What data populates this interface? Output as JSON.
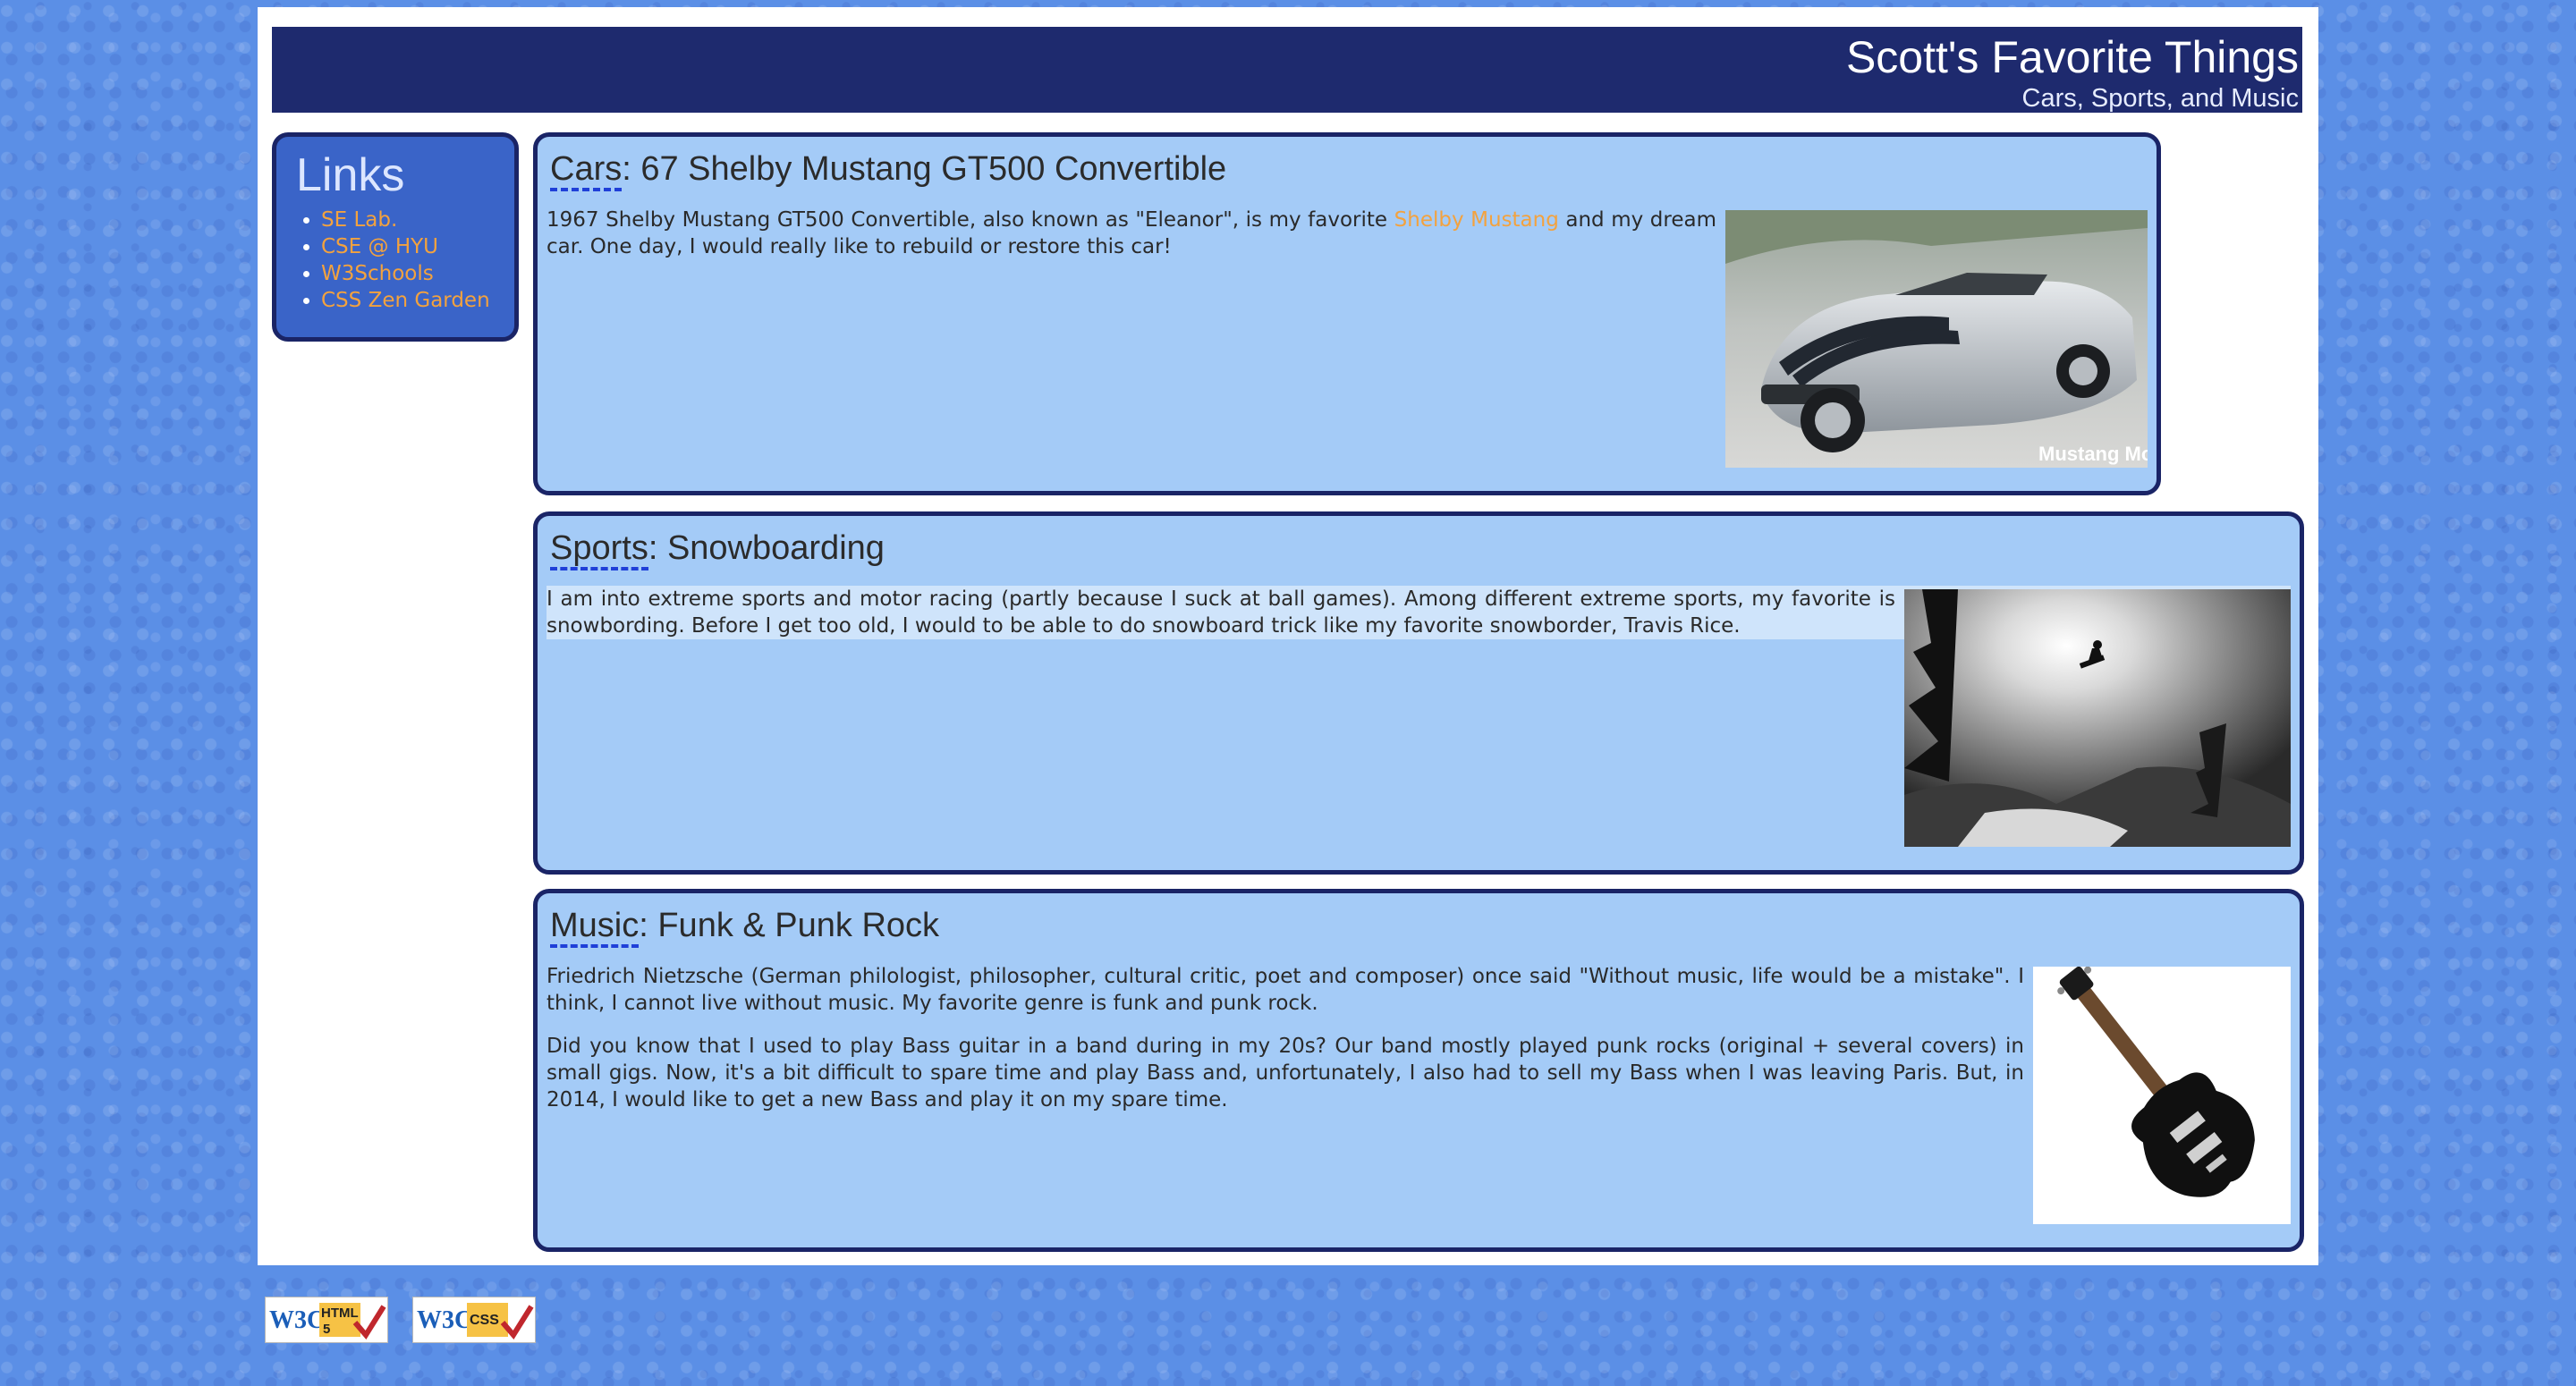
{
  "header": {
    "title": "Scott's Favorite Things",
    "subtitle": "Cars, Sports, and Music"
  },
  "sidebar": {
    "heading": "Links",
    "links": [
      "SE Lab.",
      "CSE @ HYU",
      "W3Schools",
      "CSS Zen Garden"
    ]
  },
  "sections": {
    "cars": {
      "category": "Cars",
      "title": ": 67 Shelby Mustang GT500 Convertible",
      "text_before": "1967 Shelby Mustang GT500 Convertible, also known as \"Eleanor\", is my favorite ",
      "link": "Shelby Mustang",
      "text_after": " and my dream car. One day, I would really like to rebuild or restore this car!",
      "image_watermark": "Mustang Monthly"
    },
    "sports": {
      "category": "Sports",
      "title": ": Snowboarding",
      "text": "I am into extreme sports and motor racing (partly because I suck at ball games). Among different extreme sports, my favorite is snowbording. Before I get too old, I would to be able to do snowboard trick like my favorite snowborder, Travis Rice."
    },
    "music": {
      "category": "Music",
      "title": ": Funk & Punk Rock",
      "paragraph1": "Friedrich Nietzsche (German philologist, philosopher, cultural critic, poet and composer) once said \"Without music, life would be a mistake\". I think, I cannot live without music. My favorite genre is funk and punk rock.",
      "paragraph2": "Did you know that I used to play Bass guitar in a band during in my 20s? Our band mostly played punk rocks (original + several covers) in small gigs. Now, it's a bit difficult to spare time and play Bass and, unfortunately, I also had to sell my Bass when I was leaving Paris. But, in 2014, I would like to get a new Bass and play it on my spare time."
    }
  },
  "footer": {
    "badges": [
      {
        "w3c": "W3C",
        "label": "HTML",
        "sub": "5"
      },
      {
        "w3c": "W3C",
        "label": "CSS",
        "sub": ""
      }
    ]
  },
  "colors": {
    "header_bg": "#1e2a6e",
    "panel_bg": "#a4cbf7",
    "link": "#f3a23e",
    "background": "#5b8fe6"
  }
}
